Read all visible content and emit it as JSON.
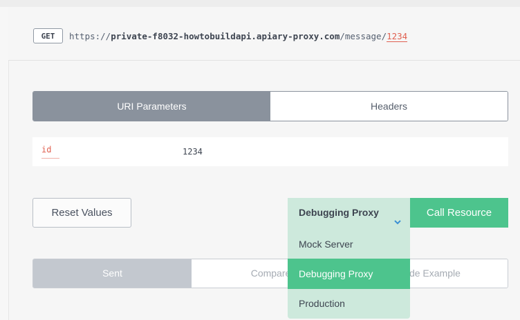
{
  "request": {
    "method": "GET",
    "url_scheme": "https://",
    "url_host": "private-f8032-howtobuildapi.apiary-proxy.com",
    "url_path": "/message/",
    "url_param": "1234"
  },
  "params_tabs": [
    {
      "label": "URI Parameters",
      "active": true
    },
    {
      "label": "Headers",
      "active": false
    }
  ],
  "uri_parameters": [
    {
      "name": "id",
      "value": "1234"
    }
  ],
  "actions": {
    "reset_label": "Reset Values",
    "environment_selected": "Debugging Proxy",
    "call_label": "Call Resource"
  },
  "environment_options": [
    {
      "label": "Mock Server",
      "selected": false
    },
    {
      "label": "Debugging Proxy",
      "selected": true
    },
    {
      "label": "Production",
      "selected": false
    }
  ],
  "result_tabs": [
    {
      "label": "Sent",
      "active": true
    },
    {
      "label": "Compare",
      "active": false
    },
    {
      "label": "Code Example",
      "active": false
    }
  ],
  "colors": {
    "accent_green": "#4dc48d",
    "dropdown_bg": "#cde9dc",
    "param_red": "#e06050",
    "chevron_blue": "#3b8fd4"
  },
  "icons": {
    "env_chevron": "chevron-down-icon"
  }
}
